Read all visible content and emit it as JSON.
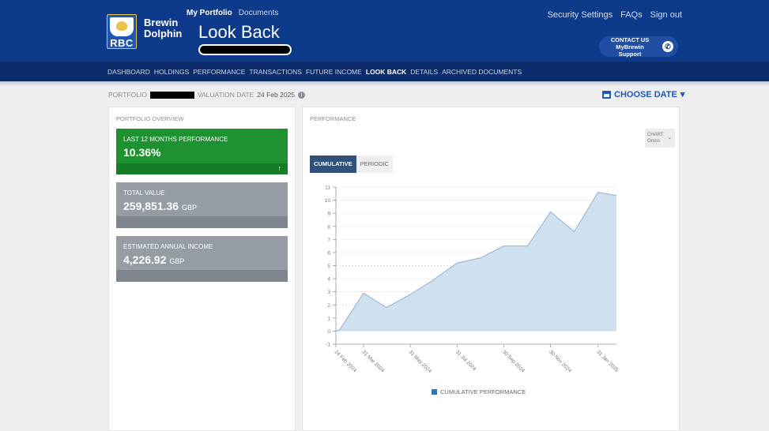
{
  "header": {
    "brand_line1": "Brewin",
    "brand_line2": "Dolphin",
    "logo_text": "RBC",
    "top_links": [
      "My Portfolio",
      "Documents"
    ],
    "page_title": "Look Back",
    "right_links": [
      "Security Settings",
      "FAQs",
      "Sign out"
    ],
    "contact_line1": "CONTACT US",
    "contact_line2": "MyBrewin Support"
  },
  "nav": {
    "tabs": [
      "DASHBOARD",
      "HOLDINGS",
      "PERFORMANCE",
      "TRANSACTIONS",
      "FUTURE INCOME",
      "LOOK BACK",
      "DETAILS",
      "ARCHIVED DOCUMENTS"
    ],
    "active": "LOOK BACK"
  },
  "portfolio_bar": {
    "portfolio_label": "PORTFOLIO",
    "valuation_label": "VALUATION DATE",
    "valuation_date": "24 Feb 2025",
    "choose_date": "CHOOSE DATE"
  },
  "overview": {
    "title": "PORTFOLIO OVERVIEW",
    "cards": [
      {
        "label": "LAST 12 MONTHS PERFORMANCE",
        "value": "10.36%",
        "unit": ""
      },
      {
        "label": "TOTAL VALUE",
        "value": "259,851.36",
        "unit": "GBP"
      },
      {
        "label": "ESTIMATED ANNUAL INCOME",
        "value": "4,226.92",
        "unit": "GBP"
      }
    ]
  },
  "performance": {
    "title": "PERFORMANCE",
    "chart_select_label": "CHART",
    "chart_select_value": "Gross",
    "toggle": [
      "CUMULATIVE",
      "PERIODIC"
    ],
    "active_toggle": "CUMULATIVE",
    "legend": "CUMULATIVE PERFORMANCE"
  },
  "colors": {
    "header": "#0d3a8a",
    "nav": "#0b2c68",
    "green_card": "#1e9130",
    "grey_card": "#959ca4",
    "area_fill": "#cfe0ef",
    "area_line": "#8fb1d4",
    "accent": "#1f56b7"
  },
  "chart_data": {
    "type": "area",
    "title": "",
    "xlabel": "",
    "ylabel": "",
    "ylim": [
      -1,
      11
    ],
    "yticks": [
      -1,
      0,
      1,
      2,
      3,
      4,
      5,
      6,
      7,
      8,
      9,
      10,
      11
    ],
    "xtick_labels": [
      "24 Feb 2024",
      "31 Mar 2024",
      "31 May 2024",
      "31 Jul 2024",
      "30 Sep 2024",
      "30 Nov 2024",
      "31 Jan 2025"
    ],
    "series": [
      {
        "name": "CUMULATIVE PERFORMANCE",
        "points": [
          {
            "x": "2024-02-24",
            "y": 0
          },
          {
            "x": "2024-02-29",
            "y": 0.1
          },
          {
            "x": "2024-03-31",
            "y": 2.9
          },
          {
            "x": "2024-04-30",
            "y": 1.8
          },
          {
            "x": "2024-05-31",
            "y": 2.8
          },
          {
            "x": "2024-06-30",
            "y": 3.9
          },
          {
            "x": "2024-07-31",
            "y": 5.2
          },
          {
            "x": "2024-08-31",
            "y": 5.6
          },
          {
            "x": "2024-09-30",
            "y": 6.5
          },
          {
            "x": "2024-10-31",
            "y": 6.5
          },
          {
            "x": "2024-11-30",
            "y": 9.1
          },
          {
            "x": "2024-12-31",
            "y": 7.6
          },
          {
            "x": "2025-01-31",
            "y": 10.6
          },
          {
            "x": "2025-02-24",
            "y": 10.36
          }
        ]
      }
    ],
    "grid": true,
    "legend": "bottom"
  }
}
